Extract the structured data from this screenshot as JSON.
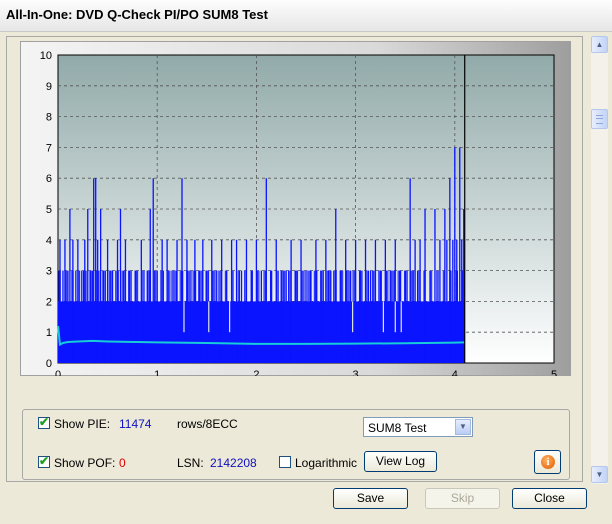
{
  "window": {
    "title": "All-In-One: DVD Q-Check PI/PO SUM8 Test"
  },
  "chart_data": {
    "type": "bar",
    "xlim": [
      0,
      5
    ],
    "ylim": [
      0,
      10
    ],
    "x_ticks": [
      "0",
      "1",
      "2",
      "3",
      "4",
      "5"
    ],
    "y_ticks": [
      "0",
      "1",
      "2",
      "3",
      "4",
      "5",
      "6",
      "7",
      "8",
      "9",
      "10"
    ],
    "grid": true,
    "data_end_x": 4.1,
    "series": [
      {
        "color": "#0a14ff",
        "baseline": 2,
        "spikes": [
          [
            0.02,
            4
          ],
          [
            0.05,
            3
          ],
          [
            0.07,
            4
          ],
          [
            0.1,
            3
          ],
          [
            0.12,
            5
          ],
          [
            0.15,
            4
          ],
          [
            0.18,
            3
          ],
          [
            0.2,
            4
          ],
          [
            0.24,
            3
          ],
          [
            0.27,
            4
          ],
          [
            0.3,
            5
          ],
          [
            0.33,
            3
          ],
          [
            0.36,
            6
          ],
          [
            0.38,
            6
          ],
          [
            0.4,
            4
          ],
          [
            0.43,
            5
          ],
          [
            0.46,
            3
          ],
          [
            0.5,
            4
          ],
          [
            0.55,
            3
          ],
          [
            0.6,
            4
          ],
          [
            0.63,
            5
          ],
          [
            0.68,
            4
          ],
          [
            0.72,
            3
          ],
          [
            0.78,
            3
          ],
          [
            0.84,
            4
          ],
          [
            0.9,
            3
          ],
          [
            0.93,
            5
          ],
          [
            0.96,
            6
          ],
          [
            1.0,
            3
          ],
          [
            1.05,
            4
          ],
          [
            1.1,
            4
          ],
          [
            1.15,
            3
          ],
          [
            1.2,
            4
          ],
          [
            1.25,
            6
          ],
          [
            1.3,
            4
          ],
          [
            1.34,
            3
          ],
          [
            1.38,
            4
          ],
          [
            1.42,
            3
          ],
          [
            1.46,
            4
          ],
          [
            1.5,
            3
          ],
          [
            1.55,
            4
          ],
          [
            1.6,
            3
          ],
          [
            1.65,
            4
          ],
          [
            1.7,
            3
          ],
          [
            1.75,
            4
          ],
          [
            1.8,
            4
          ],
          [
            1.85,
            3
          ],
          [
            1.9,
            4
          ],
          [
            1.95,
            3
          ],
          [
            2.0,
            4
          ],
          [
            2.05,
            3
          ],
          [
            2.1,
            6
          ],
          [
            2.15,
            3
          ],
          [
            2.2,
            4
          ],
          [
            2.25,
            3
          ],
          [
            2.3,
            3
          ],
          [
            2.35,
            4
          ],
          [
            2.4,
            3
          ],
          [
            2.45,
            4
          ],
          [
            2.5,
            3
          ],
          [
            2.55,
            3
          ],
          [
            2.6,
            4
          ],
          [
            2.65,
            3
          ],
          [
            2.7,
            4
          ],
          [
            2.75,
            3
          ],
          [
            2.8,
            5
          ],
          [
            2.85,
            3
          ],
          [
            2.9,
            4
          ],
          [
            2.95,
            3
          ],
          [
            3.0,
            4
          ],
          [
            3.05,
            3
          ],
          [
            3.1,
            4
          ],
          [
            3.15,
            3
          ],
          [
            3.2,
            4
          ],
          [
            3.25,
            3
          ],
          [
            3.3,
            4
          ],
          [
            3.35,
            3
          ],
          [
            3.4,
            4
          ],
          [
            3.45,
            3
          ],
          [
            3.5,
            3
          ],
          [
            3.55,
            6
          ],
          [
            3.6,
            4
          ],
          [
            3.65,
            4
          ],
          [
            3.7,
            5
          ],
          [
            3.75,
            3
          ],
          [
            3.8,
            5
          ],
          [
            3.85,
            4
          ],
          [
            3.9,
            5
          ],
          [
            3.92,
            4
          ],
          [
            3.95,
            6
          ],
          [
            3.98,
            4
          ],
          [
            4.0,
            7
          ],
          [
            4.02,
            4
          ],
          [
            4.05,
            7
          ],
          [
            4.07,
            4
          ],
          [
            4.09,
            5
          ]
        ],
        "dips": [
          1.27,
          1.52,
          1.73,
          2.97,
          3.28,
          3.4,
          3.46
        ]
      },
      {
        "color": "#16ccd8",
        "values": [
          [
            0.0,
            1.2
          ],
          [
            0.02,
            0.6
          ],
          [
            0.05,
            0.65
          ],
          [
            0.1,
            0.68
          ],
          [
            0.2,
            0.7
          ],
          [
            0.35,
            0.72
          ],
          [
            0.5,
            0.7
          ],
          [
            0.8,
            0.68
          ],
          [
            1.0,
            0.67
          ],
          [
            1.5,
            0.65
          ],
          [
            2.0,
            0.62
          ],
          [
            2.5,
            0.62
          ],
          [
            3.0,
            0.63
          ],
          [
            3.5,
            0.64
          ],
          [
            4.0,
            0.66
          ],
          [
            4.1,
            0.67
          ]
        ]
      }
    ]
  },
  "options": {
    "show_pie": {
      "label": "Show PIE:",
      "checked": true,
      "value": "11474",
      "unit": "rows/8ECC"
    },
    "show_pof": {
      "label": "Show POF:",
      "checked": true,
      "value": "0"
    },
    "lsn_label": "LSN:",
    "lsn_value": "2142208",
    "logarithmic": {
      "label": "Logarithmic",
      "checked": false
    },
    "test_select": "SUM8 Test",
    "view_log": "View Log"
  },
  "footer": {
    "save": "Save",
    "skip": "Skip",
    "close": "Close"
  },
  "icons": {
    "info": "info-icon",
    "check": "check-mark-icon",
    "dropdown": "chevron-down-icon",
    "scroll_up": "arrow-up-icon",
    "scroll_down": "arrow-down-icon"
  }
}
